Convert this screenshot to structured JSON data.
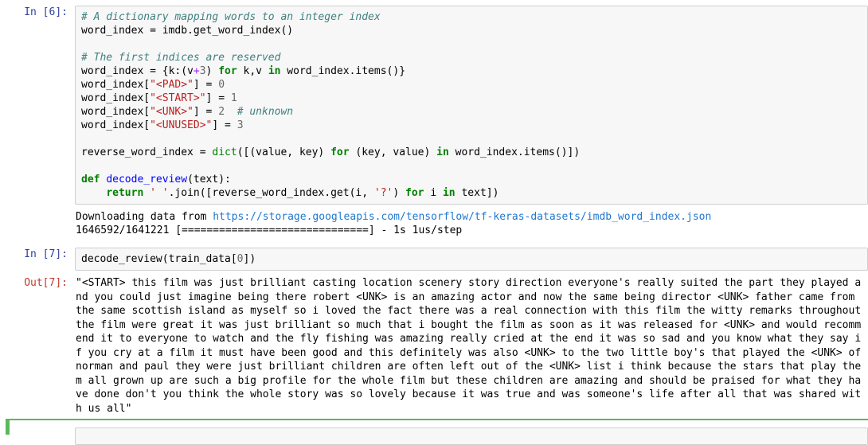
{
  "notebook": {
    "cells": [
      {
        "id": "cell-in-6",
        "type": "code",
        "prompt": "In [6]:",
        "source_lines": [
          [
            {
              "t": "c",
              "v": "# A dictionary mapping words to an integer index"
            }
          ],
          [
            {
              "t": "p",
              "v": "word_index = imdb.get_word_index()"
            }
          ],
          [
            {
              "t": "p",
              "v": ""
            }
          ],
          [
            {
              "t": "c",
              "v": "# The first indices are reserved"
            }
          ],
          [
            {
              "t": "p",
              "v": "word_index = {k:(v"
            },
            {
              "t": "op",
              "v": "+"
            },
            {
              "t": "n",
              "v": "3"
            },
            {
              "t": "p",
              "v": ") "
            },
            {
              "t": "k",
              "v": "for"
            },
            {
              "t": "p",
              "v": " k,v "
            },
            {
              "t": "k",
              "v": "in"
            },
            {
              "t": "p",
              "v": " word_index.items()}"
            }
          ],
          [
            {
              "t": "p",
              "v": "word_index["
            },
            {
              "t": "s",
              "v": "\"<PAD>\""
            },
            {
              "t": "p",
              "v": "] = "
            },
            {
              "t": "n",
              "v": "0"
            }
          ],
          [
            {
              "t": "p",
              "v": "word_index["
            },
            {
              "t": "s",
              "v": "\"<START>\""
            },
            {
              "t": "p",
              "v": "] = "
            },
            {
              "t": "n",
              "v": "1"
            }
          ],
          [
            {
              "t": "p",
              "v": "word_index["
            },
            {
              "t": "s",
              "v": "\"<UNK>\""
            },
            {
              "t": "p",
              "v": "] = "
            },
            {
              "t": "n",
              "v": "2"
            },
            {
              "t": "p",
              "v": "  "
            },
            {
              "t": "c",
              "v": "# unknown"
            }
          ],
          [
            {
              "t": "p",
              "v": "word_index["
            },
            {
              "t": "s",
              "v": "\"<UNUSED>\""
            },
            {
              "t": "p",
              "v": "] = "
            },
            {
              "t": "n",
              "v": "3"
            }
          ],
          [
            {
              "t": "p",
              "v": ""
            }
          ],
          [
            {
              "t": "p",
              "v": "reverse_word_index = "
            },
            {
              "t": "nb",
              "v": "dict"
            },
            {
              "t": "p",
              "v": "([(value, key) "
            },
            {
              "t": "k",
              "v": "for"
            },
            {
              "t": "p",
              "v": " (key, value) "
            },
            {
              "t": "k",
              "v": "in"
            },
            {
              "t": "p",
              "v": " word_index.items()])"
            }
          ],
          [
            {
              "t": "p",
              "v": ""
            }
          ],
          [
            {
              "t": "k",
              "v": "def"
            },
            {
              "t": "p",
              "v": " "
            },
            {
              "t": "nf",
              "v": "decode_review"
            },
            {
              "t": "p",
              "v": "(text):"
            }
          ],
          [
            {
              "t": "p",
              "v": "    "
            },
            {
              "t": "k",
              "v": "return"
            },
            {
              "t": "p",
              "v": " "
            },
            {
              "t": "s",
              "v": "' '"
            },
            {
              "t": "p",
              "v": ".join([reverse_word_index.get(i, "
            },
            {
              "t": "s",
              "v": "'?'"
            },
            {
              "t": "p",
              "v": ") "
            },
            {
              "t": "k",
              "v": "for"
            },
            {
              "t": "p",
              "v": " i "
            },
            {
              "t": "k",
              "v": "in"
            },
            {
              "t": "p",
              "v": " text])"
            }
          ]
        ],
        "stream_output": {
          "line1_pre": "Downloading data from ",
          "line1_url": "https://storage.googleapis.com/tensorflow/tf-keras-datasets/imdb_word_index.json",
          "line2": "1646592/1641221 [==============================] - 1s 1us/step"
        }
      },
      {
        "id": "cell-in-7",
        "type": "code",
        "prompt": "In [7]:",
        "source_lines": [
          [
            {
              "t": "p",
              "v": "decode_review(train_data["
            },
            {
              "t": "n",
              "v": "0"
            },
            {
              "t": "p",
              "v": "])"
            }
          ]
        ],
        "result": {
          "prompt": "Out[7]:",
          "text": "\"<START> this film was just brilliant casting location scenery story direction everyone's really suited the part they played and you could just imagine being there robert <UNK> is an amazing actor and now the same being director <UNK> father came from the same scottish island as myself so i loved the fact there was a real connection with this film the witty remarks throughout the film were great it was just brilliant so much that i bought the film as soon as it was released for <UNK> and would recommend it to everyone to watch and the fly fishing was amazing really cried at the end it was so sad and you know what they say if you cry at a film it must have been good and this definitely was also <UNK> to the two little boy's that played the <UNK> of norman and paul they were just brilliant children are often left out of the <UNK> list i think because the stars that play them all grown up are such a big profile for the whole film but these children are amazing and should be praised for what they have done don't you think the whole story was so lovely because it was true and was someone's life after all that was shared with us all\""
        }
      },
      {
        "id": "cell-next",
        "type": "code-empty-selected",
        "prompt": "",
        "selection_color": "#5cb85c"
      }
    ]
  },
  "theme": {
    "cell_background": "#f7f7f7",
    "cell_border": "#cfcfcf",
    "in_prompt_color": "#303f9f",
    "out_prompt_color": "#c0392b",
    "comment_color": "#408080",
    "keyword_color": "#008000",
    "string_color": "#ba2121",
    "number_color": "#666666",
    "function_color": "#0000ff",
    "operator_color": "#aa22ff",
    "link_color": "#1f77d0",
    "selected_cell_color": "#5cb85c"
  }
}
